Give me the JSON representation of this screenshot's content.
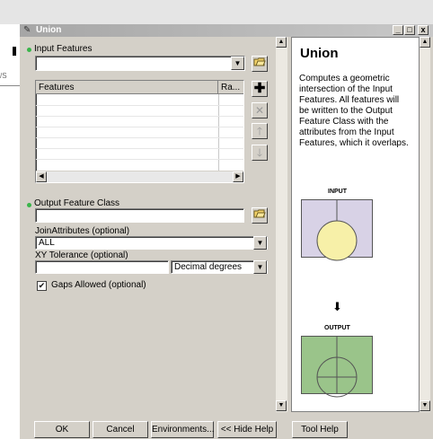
{
  "window": {
    "title": "Union",
    "minimize": "_",
    "maximize": "□",
    "close": "x"
  },
  "form": {
    "input_features_label": "Input Features",
    "input_features_value": "",
    "table_headers": [
      "Features",
      "Ra..."
    ],
    "output_class_label": "Output Feature Class",
    "output_class_value": "",
    "join_label": "JoinAttributes (optional)",
    "join_value": "ALL",
    "xy_label": "XY Tolerance (optional)",
    "xy_value": "",
    "xy_units": "Decimal degrees",
    "gaps_label": "Gaps Allowed (optional)",
    "gaps_checked": true
  },
  "help": {
    "title": "Union",
    "description": "Computes a geometric intersection of the Input Features. All features will be written to the Output Feature Class with the attributes from the Input Features, which it overlaps.",
    "input_label": "INPUT",
    "output_label": "OUTPUT",
    "colors": {
      "input_left": "#d8d2e6",
      "input_circle": "#f7f0a8",
      "output_fill": "#9ac48a"
    }
  },
  "buttons": {
    "ok": "OK",
    "cancel": "Cancel",
    "environments": "Environments...",
    "hide_help": "<< Hide Help",
    "tool_help": "Tool Help"
  },
  "icons": {
    "title": "hammer-icon",
    "add": "plus-icon",
    "remove": "x-icon",
    "up": "arrow-up-icon",
    "down": "arrow-down-icon",
    "browse": "folder-icon"
  }
}
